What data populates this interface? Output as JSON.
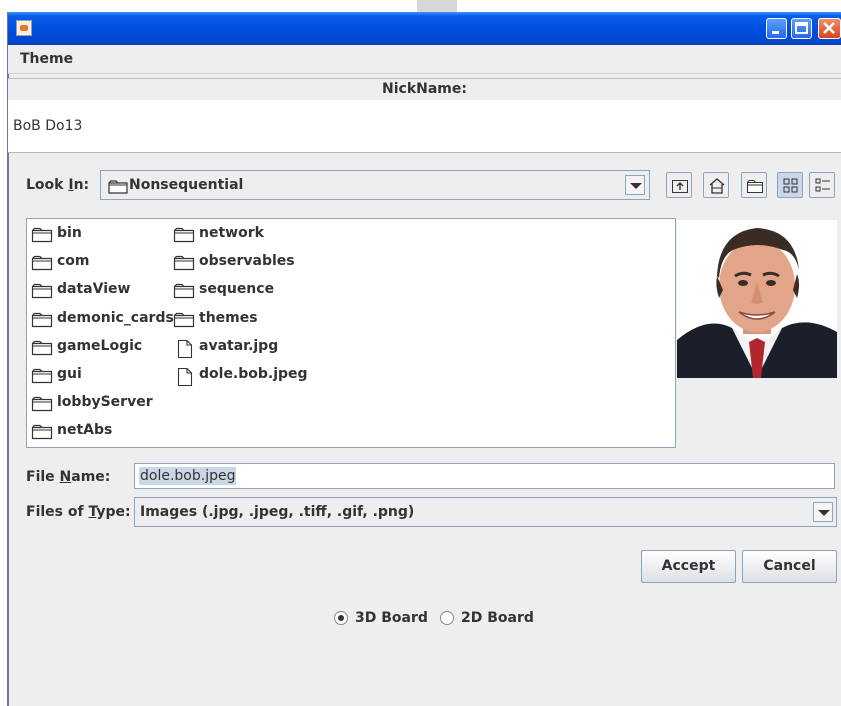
{
  "window": {
    "menu": {
      "theme": "Theme"
    }
  },
  "nickname": {
    "header": "NickName:",
    "value": "BoB Do13"
  },
  "chooser": {
    "look_in_label": "Look In:",
    "look_in_value": "Nonsequential",
    "files": [
      {
        "name": "bin",
        "type": "folder"
      },
      {
        "name": "com",
        "type": "folder"
      },
      {
        "name": "dataView",
        "type": "folder"
      },
      {
        "name": "demonic_cards",
        "type": "folder"
      },
      {
        "name": "gameLogic",
        "type": "folder"
      },
      {
        "name": "gui",
        "type": "folder"
      },
      {
        "name": "lobbyServer",
        "type": "folder"
      },
      {
        "name": "netAbs",
        "type": "folder"
      },
      {
        "name": "network",
        "type": "folder"
      },
      {
        "name": "observables",
        "type": "folder"
      },
      {
        "name": "sequence",
        "type": "folder"
      },
      {
        "name": "themes",
        "type": "folder"
      },
      {
        "name": "avatar.jpg",
        "type": "file"
      },
      {
        "name": "dole.bob.jpeg",
        "type": "file"
      }
    ],
    "file_name_label": "File Name:",
    "file_name_value": "dole.bob.jpeg",
    "files_of_type_label": "Files of Type:",
    "files_of_type_value": "Images (.jpg, .jpeg, .tiff, .gif, .png)",
    "accept": "Accept",
    "cancel": "Cancel"
  },
  "board": {
    "option_3d": "3D Board",
    "option_2d": "2D Board",
    "selected": "3D Board"
  }
}
